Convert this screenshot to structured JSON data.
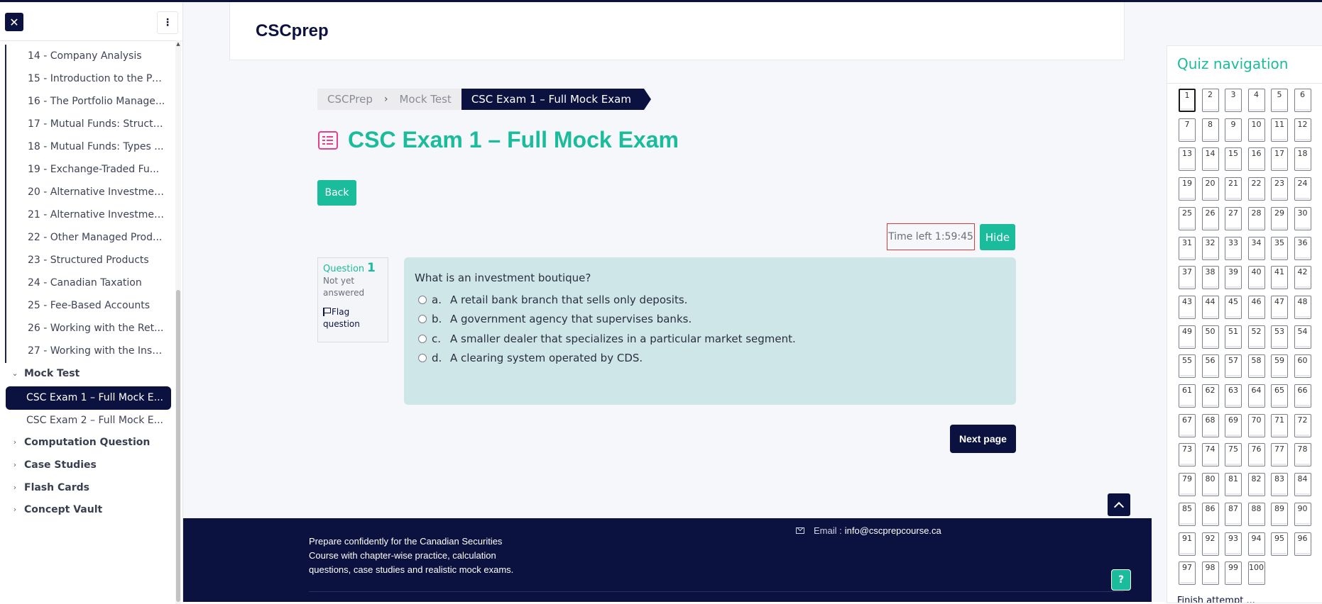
{
  "sidebar": {
    "items": [
      "14 - Company Analysis",
      "15 - Introduction to the Po...",
      "16 - The Portfolio Manage...",
      "17 - Mutual Funds: Structu...",
      "18 - Mutual Funds: Types ...",
      "19 - Exchange-Traded Fu...",
      "20 - Alternative Investmen...",
      "21 - Alternative Investmen...",
      "22 - Other Managed Prod...",
      "23 - Structured Products",
      "24 - Canadian Taxation",
      "25 - Fee-Based Accounts",
      "26 - Working with the Ret...",
      "27 - Working with the Instit..."
    ],
    "mock_section": "Mock Test",
    "mock_items": [
      "CSC Exam 1 – Full Mock E...",
      "CSC Exam 2 – Full Mock E..."
    ],
    "sections": [
      "Computation Question",
      "Case Studies",
      "Flash Cards",
      "Concept Vault"
    ]
  },
  "header": {
    "brand": "CSCprep"
  },
  "breadcrumb": [
    "CSCPrep",
    "Mock Test",
    "CSC Exam 1 – Full Mock Exam"
  ],
  "page": {
    "title": "CSC Exam 1 – Full Mock Exam",
    "back_label": "Back",
    "timer_label": "Time left 1:59:45",
    "hide_label": "Hide",
    "next_label": "Next page"
  },
  "question": {
    "label": "Question",
    "number": "1",
    "status": "Not yet answered",
    "flag_label": "Flag question",
    "text": "What is an investment boutique?",
    "options": [
      {
        "letter": "a.",
        "text": "A retail bank branch that sells only deposits."
      },
      {
        "letter": "b.",
        "text": "A government agency that supervises banks."
      },
      {
        "letter": "c.",
        "text": "A smaller dealer that specializes in a particular market segment."
      },
      {
        "letter": "d.",
        "text": "A clearing system operated by CDS."
      }
    ]
  },
  "footer": {
    "description": "Prepare confidently for the Canadian Securities Course with chapter-wise practice, calculation questions, case studies and realistic mock exams.",
    "email_label": "Email :",
    "email": "info@cscprepcourse.ca",
    "help_label": "?"
  },
  "quiz_nav": {
    "title": "Quiz navigation",
    "total_questions": 100,
    "current": 1,
    "finish_label": "Finish attempt ..."
  },
  "colors": {
    "navy": "#0c1240",
    "teal": "#1abc9c",
    "pink": "#e73f8a",
    "question_bg": "#cfe6e8"
  }
}
